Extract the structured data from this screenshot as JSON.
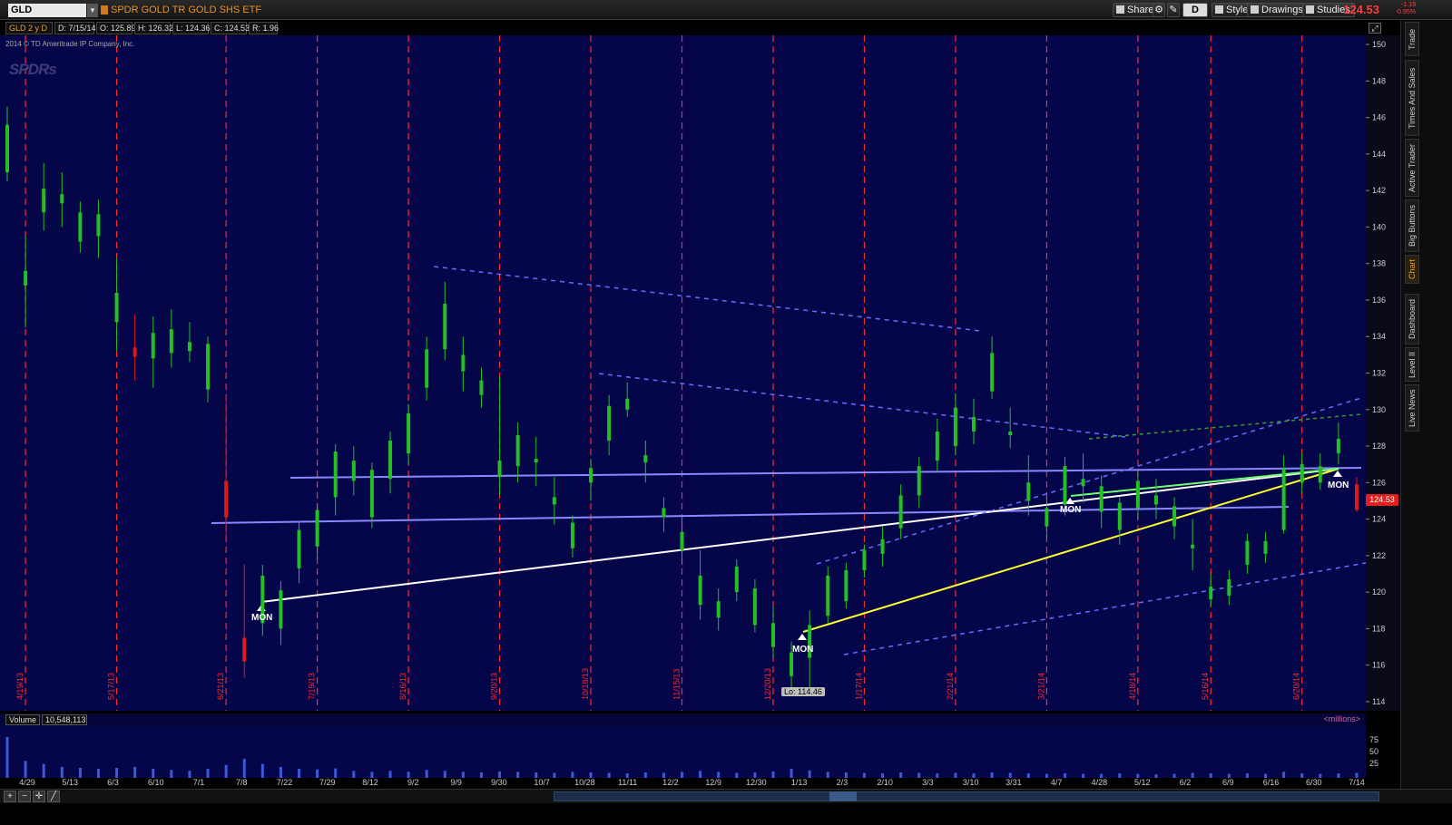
{
  "topbar": {
    "symbol": "GLD",
    "description": "SPDR GOLD TR GOLD SHS ETF",
    "buttons": [
      {
        "label": "Share",
        "icon": "share-icon"
      },
      {
        "label": "D",
        "icon": "aggregation-icon"
      },
      {
        "label": "Style",
        "icon": "style-icon"
      },
      {
        "label": "Drawings",
        "icon": "pencil-icon"
      },
      {
        "label": "Studies",
        "icon": "studies-icon"
      }
    ],
    "last_price": "124.53",
    "change_abs": "-1.19",
    "change_pct": "-0.95%"
  },
  "ohlc": {
    "period": "GLD 2 y D",
    "date": "D: 7/15/14",
    "open": "O: 125.89",
    "high": "H: 126.32",
    "low": "L: 124.36",
    "close": "C: 124.53",
    "range": "R: 1.96"
  },
  "chart": {
    "copyright": "2014 © TD Ameritrade IP Company, Inc.",
    "watermark": "SPDRs",
    "low_label": "Lo: 114.46",
    "mon_label": "MON",
    "last_tag": "124.53",
    "price_ticks": [
      "150",
      "148",
      "146",
      "144",
      "142",
      "140",
      "138",
      "136",
      "134",
      "132",
      "130",
      "128",
      "126",
      "124",
      "122",
      "120",
      "118",
      "116",
      "114"
    ],
    "period_separators": [
      "4/19/13",
      "5/17/13",
      "6/21/13",
      "7/19/13",
      "8/16/13",
      "9/20/13",
      "10/18/13",
      "11/15/13",
      "12/20/13",
      "1/17/14",
      "2/21/14",
      "3/21/14",
      "4/18/14",
      "5/16/14",
      "6/20/14"
    ],
    "colors": {
      "background": "#05054a",
      "up": "#22c022",
      "down": "#e01818",
      "separator": "#ff2a2a"
    }
  },
  "volume": {
    "label": "Volume",
    "value": "10,548,113",
    "units": "<millions>",
    "axis_ticks": [
      "75",
      "50",
      "25"
    ]
  },
  "date_axis": [
    "4/29",
    "5/13",
    "6/3",
    "6/10",
    "7/1",
    "7/8",
    "7/22",
    "7/29",
    "8/12",
    "9/2",
    "9/9",
    "9/30",
    "10/7",
    "10/28",
    "11/11",
    "12/2",
    "12/9",
    "12/30",
    "1/13",
    "2/3",
    "2/10",
    "3/3",
    "3/10",
    "3/31",
    "4/7",
    "4/28",
    "5/12",
    "6/2",
    "6/9",
    "6/16",
    "6/30",
    "7/14"
  ],
  "sidebar_tabs": [
    "Trade",
    "Times And Sales",
    "Active Trader",
    "Big Buttons",
    "Chart",
    "Dashboard",
    "Level II",
    "Live News"
  ],
  "chart_data": {
    "type": "candlestick",
    "title": "SPDR GOLD TR GOLD SHS ETF",
    "ylim": [
      113.5,
      150.5
    ],
    "series": [
      {
        "values": [
          [
            0,
            143.0,
            146.6,
            142.5,
            145.6
          ],
          [
            5,
            136.8,
            139.5,
            134.5,
            137.6
          ],
          [
            10,
            140.8,
            143.5,
            139.8,
            142.1
          ],
          [
            15,
            141.3,
            143.0,
            140.0,
            141.8
          ],
          [
            20,
            139.2,
            141.4,
            138.6,
            140.8
          ],
          [
            25,
            139.5,
            141.5,
            138.3,
            140.7
          ],
          [
            30,
            134.8,
            138.3,
            133.2,
            136.4
          ],
          [
            35,
            133.4,
            135.2,
            131.6,
            132.9
          ],
          [
            40,
            132.8,
            135.1,
            131.2,
            134.2
          ],
          [
            45,
            133.1,
            135.5,
            132.3,
            134.4
          ],
          [
            50,
            133.2,
            134.8,
            132.6,
            133.7
          ],
          [
            55,
            131.1,
            134.0,
            130.4,
            133.6
          ],
          [
            60,
            126.1,
            130.8,
            123.0,
            124.1
          ],
          [
            65,
            117.5,
            121.5,
            115.3,
            116.2
          ],
          [
            70,
            118.3,
            121.5,
            117.6,
            120.9
          ],
          [
            75,
            118.0,
            120.6,
            117.1,
            120.1
          ],
          [
            80,
            121.3,
            123.9,
            120.5,
            123.4
          ],
          [
            85,
            122.5,
            124.8,
            121.8,
            124.5
          ],
          [
            90,
            125.2,
            128.1,
            124.2,
            127.7
          ],
          [
            95,
            126.1,
            128.0,
            125.3,
            127.2
          ],
          [
            100,
            124.1,
            127.1,
            123.5,
            126.7
          ],
          [
            105,
            126.2,
            128.8,
            125.4,
            128.3
          ],
          [
            110,
            127.6,
            130.3,
            127.0,
            129.8
          ],
          [
            115,
            131.2,
            134.0,
            130.5,
            133.3
          ],
          [
            120,
            133.3,
            137.0,
            132.7,
            135.8
          ],
          [
            125,
            132.1,
            134.0,
            131.0,
            133.0
          ],
          [
            130,
            130.8,
            132.3,
            130.1,
            131.6
          ],
          [
            135,
            126.3,
            131.8,
            125.3,
            127.2
          ],
          [
            140,
            126.9,
            129.3,
            126.0,
            128.6
          ],
          [
            145,
            127.1,
            128.5,
            125.8,
            127.3
          ],
          [
            150,
            124.8,
            126.3,
            123.7,
            125.2
          ],
          [
            155,
            122.4,
            124.2,
            121.9,
            123.8
          ],
          [
            160,
            126.0,
            127.3,
            125.0,
            126.8
          ],
          [
            165,
            128.3,
            130.8,
            127.5,
            130.2
          ],
          [
            170,
            130.0,
            131.5,
            129.6,
            130.6
          ],
          [
            175,
            127.1,
            128.3,
            126.0,
            127.5
          ],
          [
            180,
            124.1,
            125.2,
            123.3,
            124.6
          ],
          [
            185,
            122.3,
            124.0,
            121.5,
            123.3
          ],
          [
            190,
            119.3,
            122.3,
            118.5,
            120.9
          ],
          [
            195,
            118.6,
            120.2,
            117.9,
            119.5
          ],
          [
            200,
            120.0,
            121.8,
            119.5,
            121.4
          ],
          [
            205,
            118.2,
            120.7,
            117.8,
            120.2
          ],
          [
            210,
            117.0,
            119.2,
            116.4,
            118.3
          ],
          [
            215,
            115.4,
            117.3,
            114.5,
            116.7
          ],
          [
            220,
            116.4,
            119.0,
            114.5,
            118.2
          ],
          [
            225,
            118.7,
            121.4,
            118.3,
            120.9
          ],
          [
            230,
            119.5,
            121.6,
            119.1,
            121.2
          ],
          [
            235,
            121.2,
            122.6,
            120.8,
            122.3
          ],
          [
            240,
            122.1,
            123.6,
            121.4,
            122.9
          ],
          [
            245,
            123.5,
            125.9,
            122.9,
            125.3
          ],
          [
            250,
            125.3,
            127.4,
            124.6,
            126.9
          ],
          [
            255,
            127.2,
            129.5,
            126.6,
            128.8
          ],
          [
            260,
            128.0,
            130.9,
            127.5,
            130.1
          ],
          [
            265,
            128.8,
            130.6,
            128.1,
            129.6
          ],
          [
            270,
            131.0,
            134.0,
            130.6,
            133.1
          ],
          [
            275,
            128.6,
            130.1,
            127.9,
            128.8
          ],
          [
            280,
            125.0,
            127.5,
            124.2,
            126.0
          ],
          [
            285,
            123.6,
            125.2,
            123.0,
            124.6
          ],
          [
            290,
            124.8,
            127.4,
            124.2,
            126.9
          ],
          [
            295,
            125.8,
            127.6,
            124.9,
            126.2
          ],
          [
            300,
            124.4,
            126.4,
            123.5,
            125.8
          ],
          [
            305,
            123.4,
            125.2,
            122.6,
            124.9
          ],
          [
            310,
            124.6,
            126.6,
            124.0,
            126.1
          ],
          [
            315,
            124.8,
            126.2,
            124.0,
            125.3
          ],
          [
            320,
            123.6,
            125.2,
            122.9,
            124.7
          ],
          [
            325,
            122.4,
            124.0,
            121.2,
            122.6
          ],
          [
            330,
            119.6,
            121.0,
            119.2,
            120.3
          ],
          [
            335,
            119.8,
            121.2,
            119.3,
            120.7
          ],
          [
            340,
            121.5,
            123.2,
            121.0,
            122.8
          ],
          [
            345,
            122.1,
            123.3,
            121.6,
            122.8
          ],
          [
            350,
            123.4,
            127.5,
            123.2,
            126.8
          ],
          [
            355,
            126.0,
            127.6,
            125.4,
            127.0
          ],
          [
            360,
            126.0,
            127.6,
            125.6,
            126.9
          ],
          [
            365,
            127.6,
            129.3,
            127.0,
            128.4
          ],
          [
            370,
            125.9,
            126.3,
            124.4,
            124.5
          ]
        ]
      }
    ],
    "x_span": [
      0,
      370
    ],
    "separators_x": [
      5,
      30,
      60,
      85,
      110,
      135,
      160,
      185,
      210,
      235,
      260,
      285,
      310,
      330,
      355
    ],
    "volume": [
      [
        0,
        82
      ],
      [
        5,
        34
      ],
      [
        10,
        28
      ],
      [
        15,
        22
      ],
      [
        20,
        20
      ],
      [
        25,
        18
      ],
      [
        30,
        20
      ],
      [
        35,
        22
      ],
      [
        40,
        18
      ],
      [
        45,
        16
      ],
      [
        50,
        14
      ],
      [
        55,
        18
      ],
      [
        60,
        26
      ],
      [
        65,
        38
      ],
      [
        70,
        28
      ],
      [
        75,
        22
      ],
      [
        80,
        18
      ],
      [
        85,
        17
      ],
      [
        90,
        19
      ],
      [
        95,
        14
      ],
      [
        100,
        12
      ],
      [
        105,
        14
      ],
      [
        110,
        12
      ],
      [
        115,
        16
      ],
      [
        120,
        14
      ],
      [
        125,
        12
      ],
      [
        130,
        11
      ],
      [
        135,
        13
      ],
      [
        140,
        12
      ],
      [
        145,
        11
      ],
      [
        150,
        10
      ],
      [
        155,
        12
      ],
      [
        160,
        11
      ],
      [
        165,
        10
      ],
      [
        170,
        9
      ],
      [
        175,
        11
      ],
      [
        180,
        10
      ],
      [
        185,
        12
      ],
      [
        190,
        14
      ],
      [
        195,
        12
      ],
      [
        200,
        10
      ],
      [
        205,
        11
      ],
      [
        210,
        13
      ],
      [
        215,
        18
      ],
      [
        220,
        15
      ],
      [
        225,
        12
      ],
      [
        230,
        11
      ],
      [
        235,
        10
      ],
      [
        240,
        9
      ],
      [
        245,
        11
      ],
      [
        250,
        10
      ],
      [
        255,
        9
      ],
      [
        260,
        10
      ],
      [
        265,
        9
      ],
      [
        270,
        11
      ],
      [
        275,
        10
      ],
      [
        280,
        9
      ],
      [
        285,
        8
      ],
      [
        290,
        9
      ],
      [
        295,
        8
      ],
      [
        300,
        8
      ],
      [
        305,
        9
      ],
      [
        310,
        8
      ],
      [
        315,
        7
      ],
      [
        320,
        8
      ],
      [
        325,
        10
      ],
      [
        330,
        9
      ],
      [
        335,
        8
      ],
      [
        340,
        9
      ],
      [
        345,
        8
      ],
      [
        350,
        12
      ],
      [
        355,
        9
      ],
      [
        360,
        8
      ],
      [
        365,
        9
      ],
      [
        370,
        10
      ]
    ]
  }
}
